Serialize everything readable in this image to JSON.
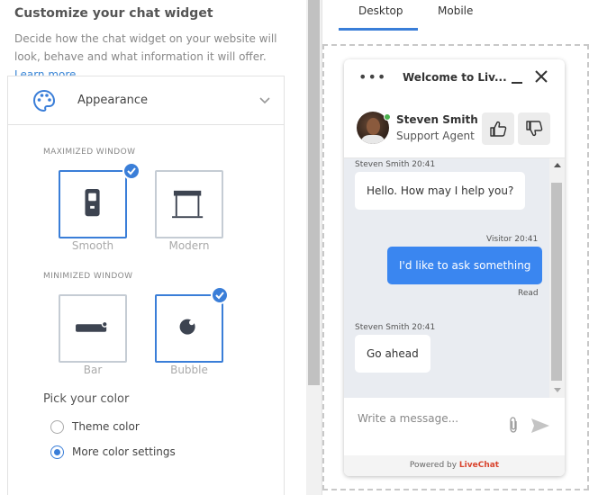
{
  "settings": {
    "heading": "Customize your chat widget",
    "description": "Decide how the chat widget on your website will look, behave and  what information it will offer.",
    "learn_more": "Learn more…",
    "section_title": "Appearance",
    "maximized_label": "MAXIMIZED WINDOW",
    "minimized_label": "MINIMIZED WINDOW",
    "maximized_options": [
      {
        "label": "Smooth",
        "selected": true
      },
      {
        "label": "Modern",
        "selected": false
      }
    ],
    "minimized_options": [
      {
        "label": "Bar",
        "selected": false
      },
      {
        "label": "Bubble",
        "selected": true
      }
    ],
    "pick_color": "Pick your color",
    "color_options": [
      {
        "label": "Theme color",
        "selected": false
      },
      {
        "label": "More color settings",
        "selected": true
      }
    ]
  },
  "preview": {
    "tabs": [
      {
        "label": "Desktop",
        "active": true
      },
      {
        "label": "Mobile",
        "active": false
      }
    ],
    "widget": {
      "title": "Welcome to Liv...",
      "agent_name": "Steven Smith",
      "agent_role": "Support Agent",
      "messages": [
        {
          "meta": "Steven Smith 20:41",
          "text": "Hello. How may I help you?",
          "from": "agent"
        },
        {
          "meta": "Visitor 20:41",
          "text": "I'd like to ask something",
          "from": "visitor",
          "status": "Read"
        },
        {
          "meta": "Steven Smith 20:41",
          "text": "Go ahead",
          "from": "agent"
        }
      ],
      "input_placeholder": "Write a message...",
      "powered_prefix": "Powered by ",
      "powered_brand": "LiveChat"
    }
  },
  "colors": {
    "accent": "#3a7ed8",
    "visitor_bubble": "#3a86f0",
    "brand": "#d9442e",
    "online": "#4bb24e"
  }
}
